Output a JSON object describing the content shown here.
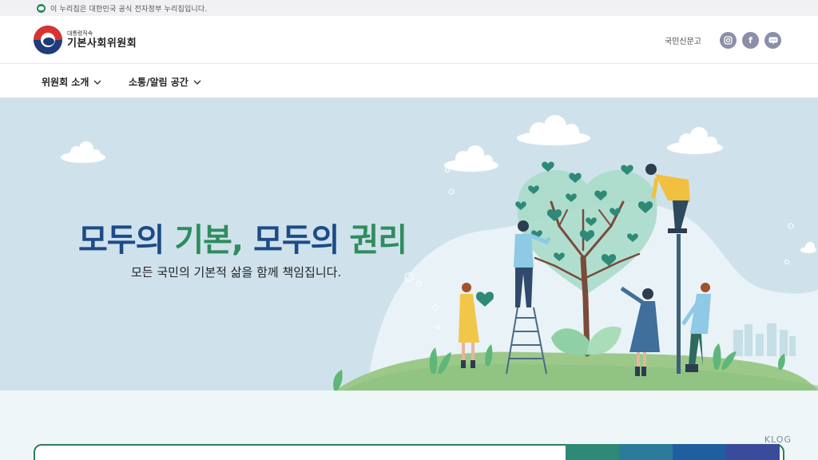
{
  "gov_banner": {
    "text": "이 누리집은 대한민국 공식 전자정부 누리집입니다.",
    "icon": "korea-flag-icon"
  },
  "header": {
    "logo_small": "대통령직속",
    "logo_big": "기본사회위원회",
    "petition_label": "국민신문고",
    "sns": [
      {
        "name": "instagram-icon",
        "glyph": "instagram"
      },
      {
        "name": "facebook-icon",
        "glyph": "f"
      },
      {
        "name": "blog-icon",
        "glyph": "blog"
      }
    ]
  },
  "nav": {
    "items": [
      {
        "label": "위원회 소개"
      },
      {
        "label": "소통/알림 공간"
      }
    ]
  },
  "hero": {
    "title_part1": "모두의 ",
    "title_part2": "기본, ",
    "title_part3": "모두의 ",
    "title_part4": "권리",
    "subtitle": "모든 국민의 기본적 삶을 함께 책임집니다."
  },
  "watermark": "KLOG",
  "colors": {
    "brand_blue": "#1c4c87",
    "brand_green": "#2f8c5e",
    "hero_bg": "#cfe2ec",
    "tab_colors": [
      "#2e8a76",
      "#2a7c9a",
      "#1f5fa0",
      "#3a4b9a"
    ]
  }
}
